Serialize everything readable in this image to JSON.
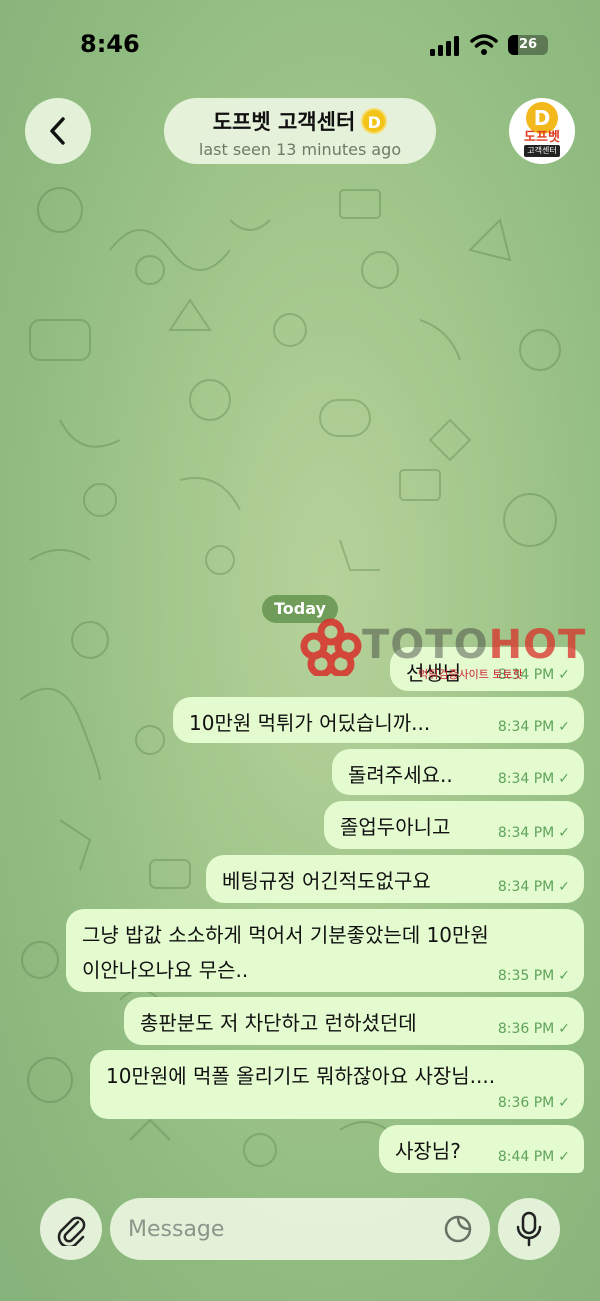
{
  "status_bar": {
    "time": "8:46",
    "battery": "26",
    "battery_level": 0.26
  },
  "header": {
    "title": "도프벳 고객센터",
    "badge": "D",
    "subtitle": "last seen 13 minutes ago",
    "avatar_letter": "D",
    "avatar_brand": "도프벳",
    "avatar_sub": "고객센터"
  },
  "date_label": "Today",
  "watermark": {
    "brand": "TOTOHOT",
    "sub": "먹튀검증사이트 토토핫"
  },
  "messages": [
    {
      "text": "선생님",
      "time": "8:34 PM",
      "status": "✓"
    },
    {
      "text": "10만원 먹튀가 어딨습니까...",
      "time": "8:34 PM",
      "status": "✓"
    },
    {
      "text": "돌려주세요..",
      "time": "8:34 PM",
      "status": "✓"
    },
    {
      "text": "졸업두아니고",
      "time": "8:34 PM",
      "status": "✓"
    },
    {
      "text": "베팅규정 어긴적도없구요",
      "time": "8:34 PM",
      "status": "✓"
    },
    {
      "text_line1": "그냥 밥값 소소하게 먹어서 기분좋았는데 10만원",
      "text_line2": "이안나오나요 무슨..",
      "time": "8:35 PM",
      "status": "✓"
    },
    {
      "text": "총판분도 저 차단하고 런하셨던데",
      "time": "8:36 PM",
      "status": "✓"
    },
    {
      "text": "10만원에 먹폴 올리기도 뭐하잖아요 사장님....",
      "time": "8:36 PM",
      "status": "✓"
    },
    {
      "text": "사장님?",
      "time": "8:44 PM",
      "status": "✓"
    }
  ],
  "composer": {
    "placeholder": "Message"
  },
  "colors": {
    "bubble": "#e4fbd0",
    "time_green": "#5ea35a",
    "accent_gold": "#f3c418",
    "watermark_red": "#d9302a"
  }
}
